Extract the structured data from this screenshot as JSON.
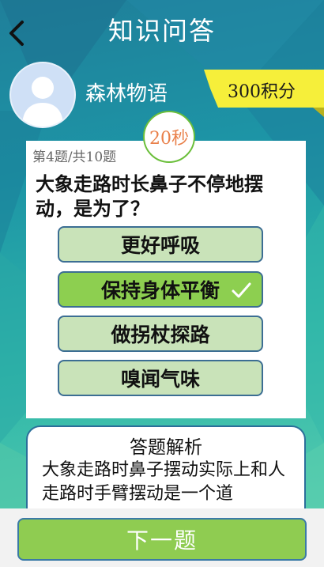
{
  "header": {
    "title": "知识问答"
  },
  "user": {
    "name": "森林物语",
    "score": "300积分"
  },
  "timer": {
    "label": "20秒"
  },
  "question": {
    "progress": "第4题/共10题",
    "text": "大象走路时长鼻子不停地摆动，是为了？",
    "options": [
      {
        "label": "更好呼吸",
        "selected": false
      },
      {
        "label": "保持身体平衡",
        "selected": true
      },
      {
        "label": "做拐杖探路",
        "selected": false
      },
      {
        "label": "嗅闻气味",
        "selected": false
      }
    ]
  },
  "analysis": {
    "title": "答题解析",
    "body": "大象走路时鼻子摆动实际上和人走路时手臂摆动是一个道"
  },
  "footer": {
    "next_label": "下一题"
  },
  "colors": {
    "option_bg": "#c9e3b9",
    "option_selected_bg": "#8dcf50",
    "timer_text": "#e9804a",
    "score_badge": "#f6ef3a",
    "next_button": "#8fcc51"
  }
}
